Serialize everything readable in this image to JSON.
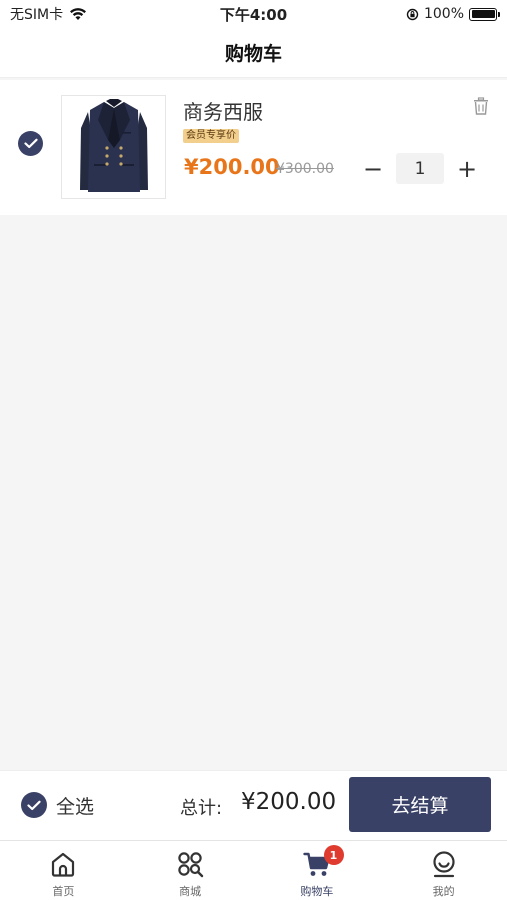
{
  "status_bar": {
    "carrier": "无SIM卡",
    "time": "下午4:00",
    "battery": "100%",
    "battery_level": 1.0
  },
  "nav": {
    "title": "购物车"
  },
  "cart": {
    "items": [
      {
        "name": "商务西服",
        "tag": "会员专享价",
        "price": "¥200.00",
        "original_price": "¥300.00",
        "quantity": "1",
        "qty_minus": "−",
        "qty_plus": "+",
        "checked": true,
        "image_icon": "suit-jacket"
      }
    ]
  },
  "checkout": {
    "select_all_label": "全选",
    "total_label": "总计:",
    "total_value": "¥200.00",
    "button_label": "去结算"
  },
  "tabbar": {
    "tabs": [
      {
        "label": "首页",
        "icon": "home-icon"
      },
      {
        "label": "商城",
        "icon": "mall-icon"
      },
      {
        "label": "购物车",
        "icon": "cart-icon",
        "badge": "1",
        "active": true
      },
      {
        "label": "我的",
        "icon": "profile-icon"
      }
    ]
  },
  "colors": {
    "accent": "#3a4166",
    "price": "#e8751a",
    "badge": "#e03b2f",
    "vip_tag": "#f3cf8d"
  }
}
